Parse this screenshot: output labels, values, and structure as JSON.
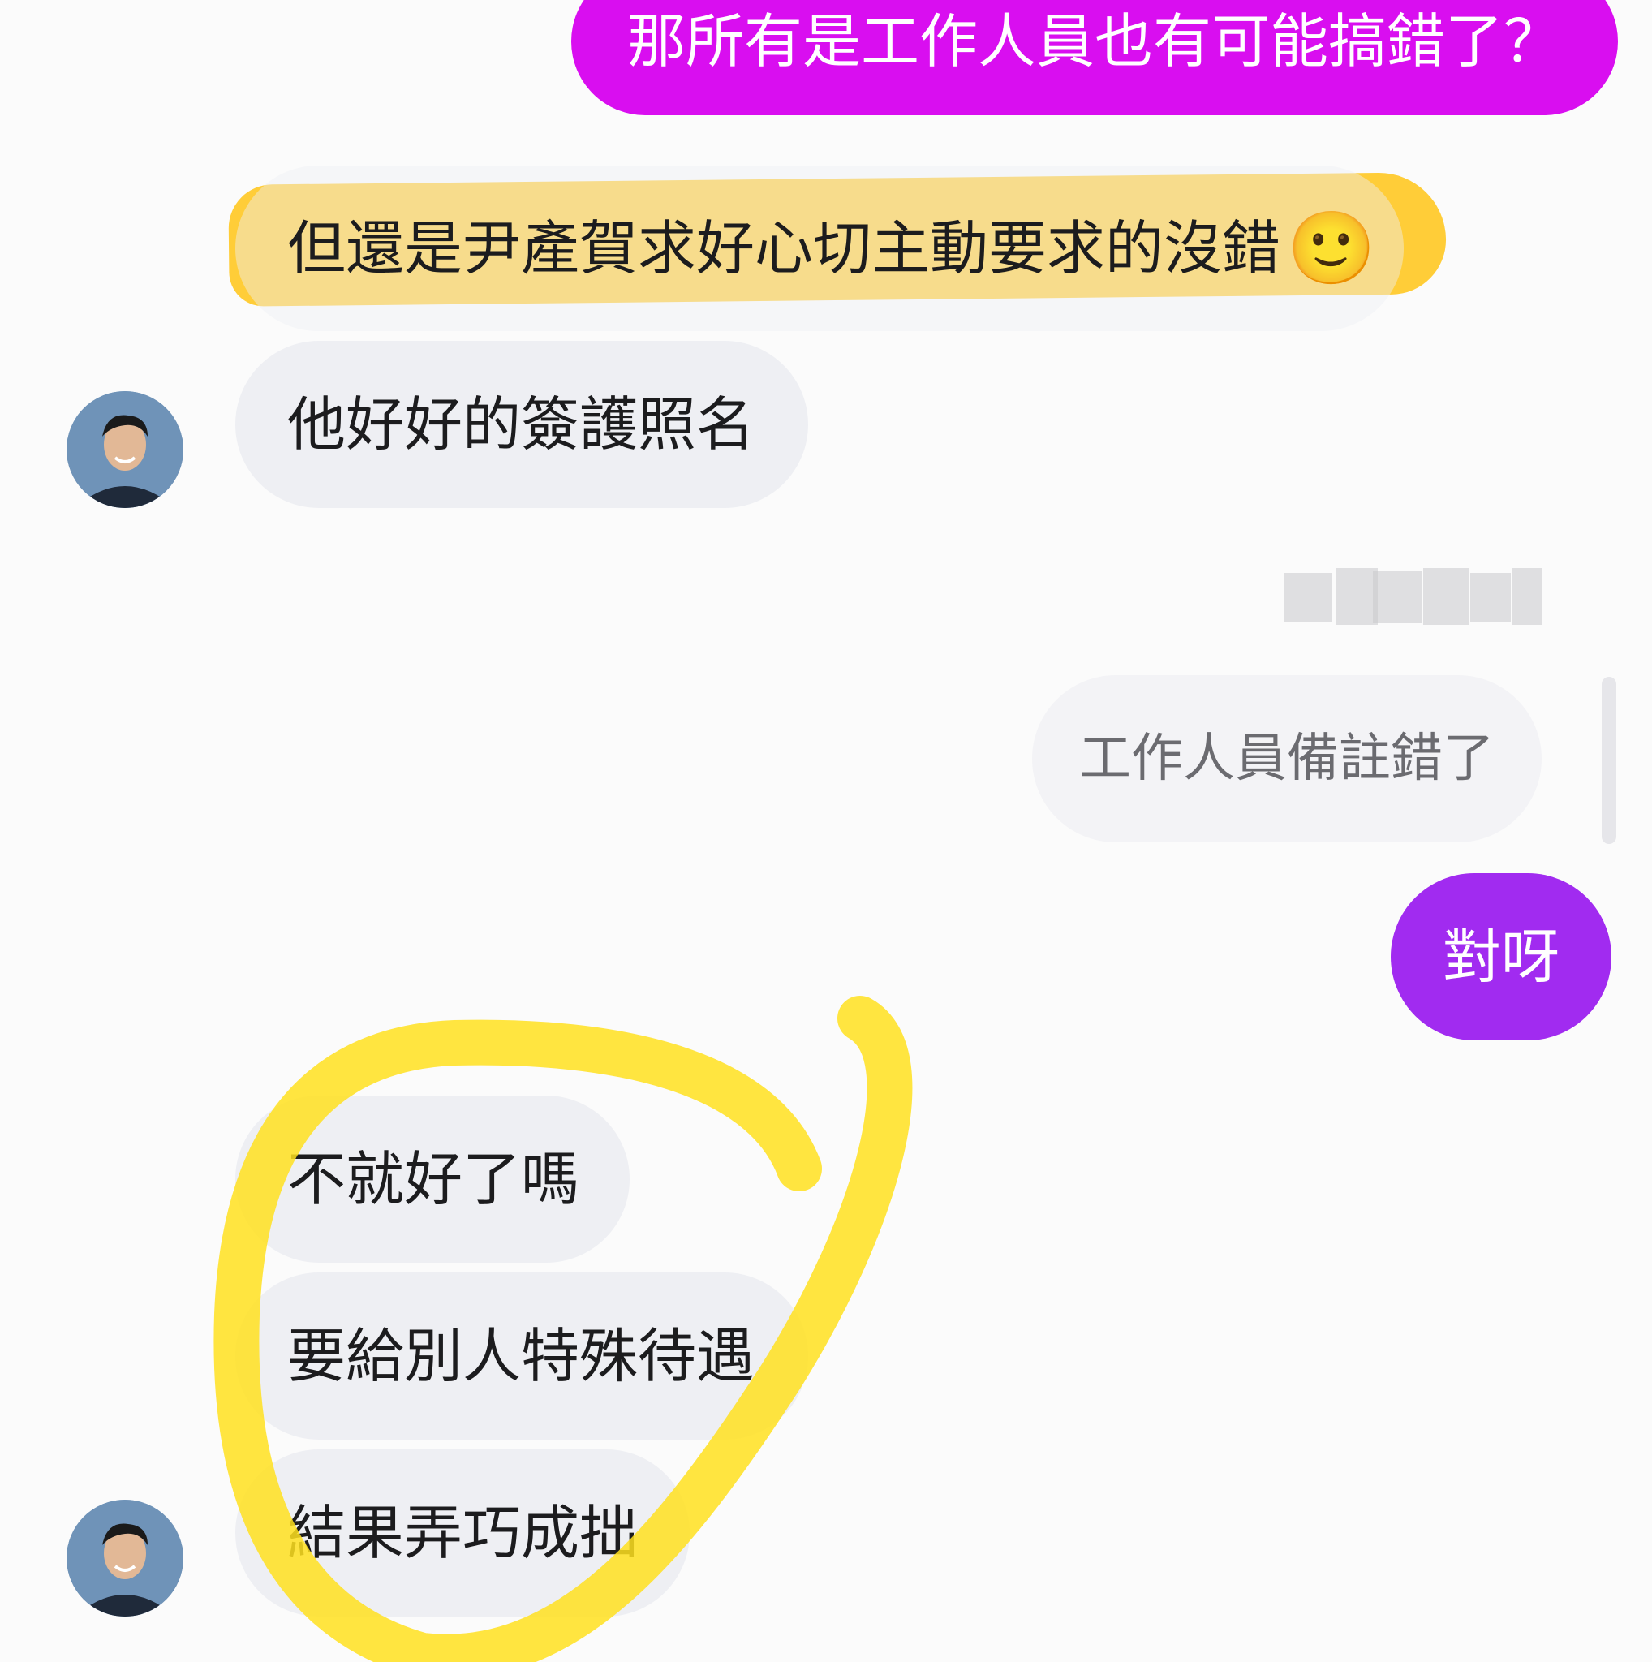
{
  "messages": {
    "out_top": "那所有是工作人員也有可能搞錯了？",
    "in_highlighted": "但還是尹產賀求好心切主動要求的沒錯",
    "in_highlighted_emoji": "🙂",
    "in_2": "他好好的簽護照名",
    "reply_quote": "工作人員備註錯了",
    "out_2": "對呀",
    "in_3": "不就好了嗎",
    "in_4": "要給別人特殊待遇",
    "in_5": "結果弄巧成拙"
  },
  "colors": {
    "outgoing_top": "#d90ef0",
    "outgoing": "#a12bf0",
    "incoming": "#eeeff3",
    "highlight": "#ffc61c",
    "circle_marker": "#ffe11f"
  }
}
